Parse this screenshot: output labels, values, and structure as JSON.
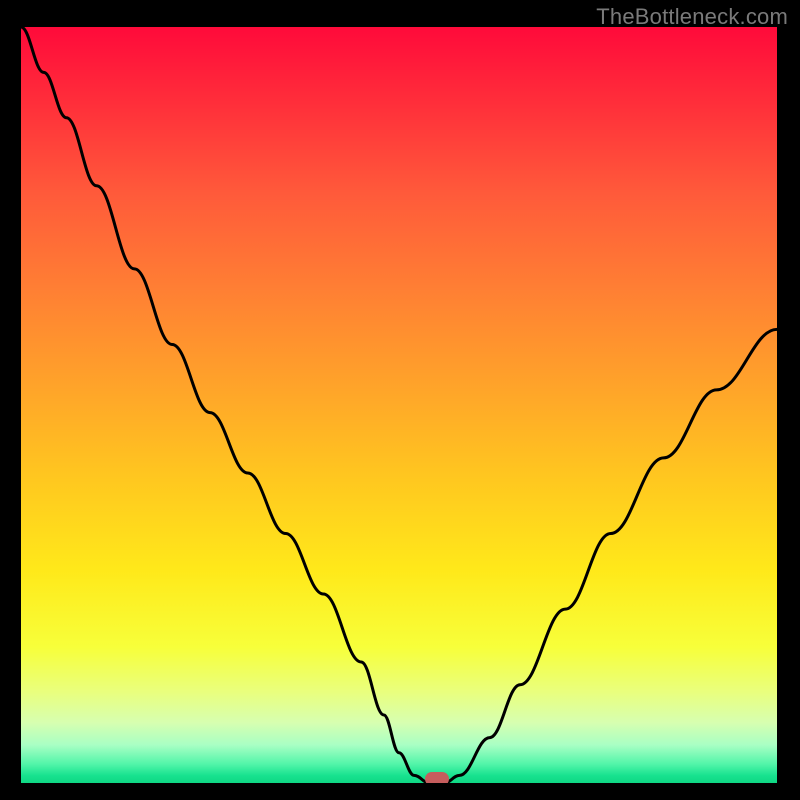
{
  "watermark": "TheBottleneck.com",
  "colors": {
    "background": "#000000",
    "curve_stroke": "#000000",
    "marker_fill": "#c65d5d",
    "watermark_text": "#7a7a7a"
  },
  "chart_data": {
    "type": "line",
    "title": "",
    "xlabel": "",
    "ylabel": "",
    "xlim": [
      0,
      100
    ],
    "ylim": [
      0,
      100
    ],
    "grid": false,
    "legend": false,
    "gradient_stops": [
      {
        "pos": 0.0,
        "color": "#ff0a3a"
      },
      {
        "pos": 0.1,
        "color": "#ff2e3a"
      },
      {
        "pos": 0.22,
        "color": "#ff5a3a"
      },
      {
        "pos": 0.34,
        "color": "#ff7d34"
      },
      {
        "pos": 0.47,
        "color": "#ffa22a"
      },
      {
        "pos": 0.6,
        "color": "#ffc81f"
      },
      {
        "pos": 0.72,
        "color": "#ffe91a"
      },
      {
        "pos": 0.82,
        "color": "#f7ff3a"
      },
      {
        "pos": 0.88,
        "color": "#e9ff7e"
      },
      {
        "pos": 0.92,
        "color": "#d7ffb0"
      },
      {
        "pos": 0.95,
        "color": "#a8ffc4"
      },
      {
        "pos": 0.975,
        "color": "#52f5a9"
      },
      {
        "pos": 0.99,
        "color": "#18e28f"
      },
      {
        "pos": 1.0,
        "color": "#0fd884"
      }
    ],
    "series": [
      {
        "name": "bottleneck-curve",
        "x": [
          0.0,
          3.0,
          6.0,
          10.0,
          15.0,
          20.0,
          25.0,
          30.0,
          35.0,
          40.0,
          45.0,
          48.0,
          50.0,
          52.0,
          54.0,
          56.0,
          58.0,
          62.0,
          66.0,
          72.0,
          78.0,
          85.0,
          92.0,
          100.0
        ],
        "y": [
          100.0,
          94.0,
          88.0,
          79.0,
          68.0,
          58.0,
          49.0,
          41.0,
          33.0,
          25.0,
          16.0,
          9.0,
          4.0,
          1.0,
          0.0,
          0.0,
          1.0,
          6.0,
          13.0,
          23.0,
          33.0,
          43.0,
          52.0,
          60.0
        ]
      }
    ],
    "marker": {
      "x": 55.0,
      "y": 0.0
    }
  }
}
